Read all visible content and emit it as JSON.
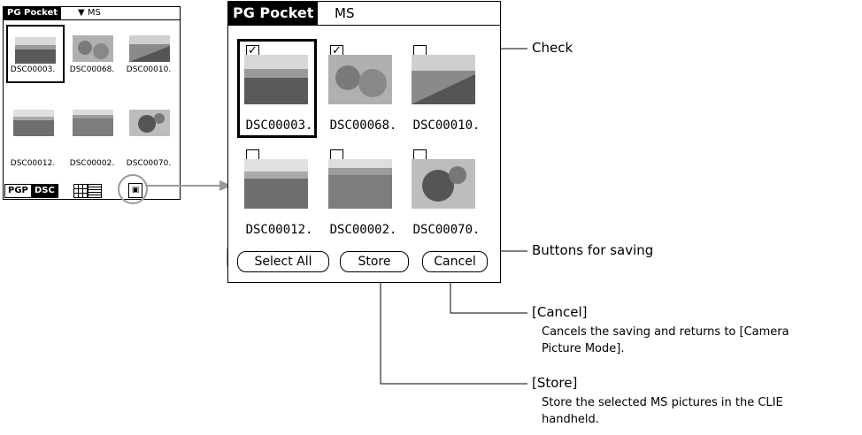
{
  "small_screen": {
    "app_name": "PG Pocket",
    "source": "MS",
    "thumbnails": [
      {
        "label": "DSC00003."
      },
      {
        "label": "DSC00068."
      },
      {
        "label": "DSC00010."
      },
      {
        "label": "DSC00012."
      },
      {
        "label": "DSC00002."
      },
      {
        "label": "DSC00070."
      }
    ],
    "footer_tabs": [
      "PGP",
      "DSC"
    ],
    "copy_icon": "copy-to-handheld-icon"
  },
  "large_screen": {
    "app_name": "PG Pocket",
    "source": "MS",
    "thumbnails": [
      {
        "label": "DSC00003.",
        "checked": true
      },
      {
        "label": "DSC00068.",
        "checked": true
      },
      {
        "label": "DSC00010.",
        "checked": false
      },
      {
        "label": "DSC00012.",
        "checked": false
      },
      {
        "label": "DSC00002.",
        "checked": false
      },
      {
        "label": "DSC00070.",
        "checked": false
      }
    ],
    "buttons": {
      "select_all": "Select All",
      "store": "Store",
      "cancel": "Cancel"
    }
  },
  "callouts": {
    "check": "Check",
    "buttons_for_saving": "Buttons for saving",
    "cancel_title": "[Cancel]",
    "cancel_desc_1": "Cancels the saving and returns to [Camera",
    "cancel_desc_2": "Picture Mode].",
    "store_title": "[Store]",
    "store_desc_1": "Store the selected MS pictures in the CLIE",
    "store_desc_2": "handheld."
  }
}
